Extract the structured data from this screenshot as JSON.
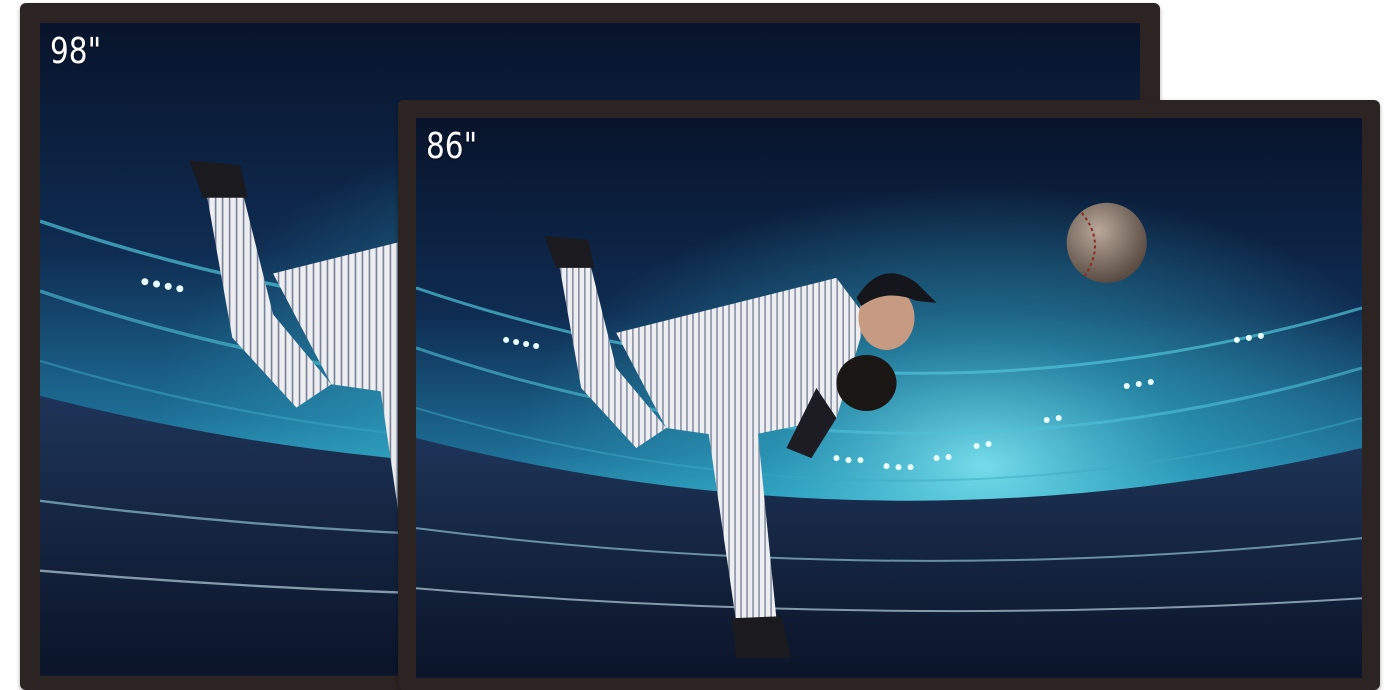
{
  "displays": [
    {
      "size_label": "98\""
    },
    {
      "size_label": "86\""
    }
  ],
  "colors": {
    "bezel": "#2b2422",
    "sky_dark": "#0a1a33",
    "stadium_glow": "#3fc0d8",
    "uniform": "#e8e8ec"
  }
}
